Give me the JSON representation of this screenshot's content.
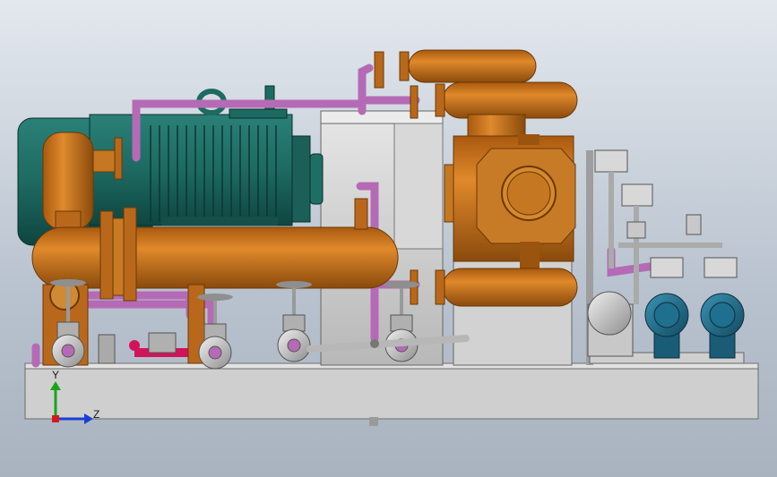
{
  "viewport": {
    "colors": {
      "orange": "#c8731d",
      "orange_dark": "#8a4a0c",
      "green": "#1f6e66",
      "green_dark": "#0f4540",
      "magenta": "#b56ab6",
      "gray": "#d4d4d4",
      "base": "#cfcfcf",
      "blue": "#1f6f8e"
    },
    "triad": {
      "y_label": "Y",
      "z_label": "Z",
      "x_color": "#d61a1a",
      "y_color": "#1aa31a",
      "z_color": "#1a3fd6"
    }
  }
}
